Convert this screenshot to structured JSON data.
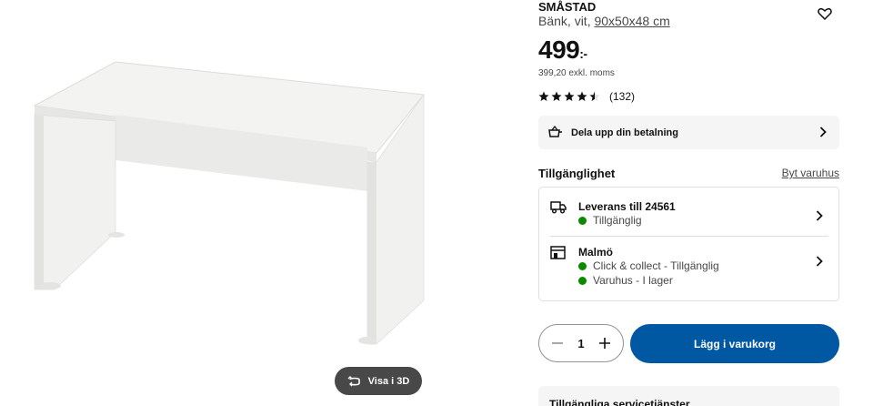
{
  "product": {
    "name": "SMÅSTAD",
    "description": "Bänk, vit,",
    "dimensions": "90x50x48 cm",
    "price": "499",
    "price_suffix": ":-",
    "price_excl_vat": "399,20 exkl. moms",
    "rating_stars": 4.5,
    "rating_count": "(132)"
  },
  "media": {
    "view_3d_label": "Visa i 3D"
  },
  "payment_banner": {
    "label": "Dela upp din betalning"
  },
  "availability": {
    "heading": "Tillgänglighet",
    "change_store": "Byt varuhus",
    "delivery": {
      "title": "Leverans till 24561",
      "status": "Tillgänglig"
    },
    "store": {
      "title": "Malmö",
      "status_collect": "Click & collect - Tillgänglig",
      "status_stock": "Varuhus - I lager"
    }
  },
  "cart": {
    "quantity": "1",
    "add_label": "Lägg i varukorg"
  },
  "services": {
    "heading": "Tillgängliga servicetjänster"
  },
  "colors": {
    "primary_blue": "#0058a3",
    "available_green": "#0a8a00",
    "banner_grey": "#f5f5f5",
    "dark_pill": "#484848"
  },
  "icons": {
    "favorite": "heart-icon",
    "payment": "payment-split-icon",
    "delivery": "truck-icon",
    "store": "store-icon",
    "chevron": "chevron-right-icon",
    "rotate": "rotate-3d-icon",
    "minus": "minus-icon",
    "plus": "plus-icon"
  }
}
